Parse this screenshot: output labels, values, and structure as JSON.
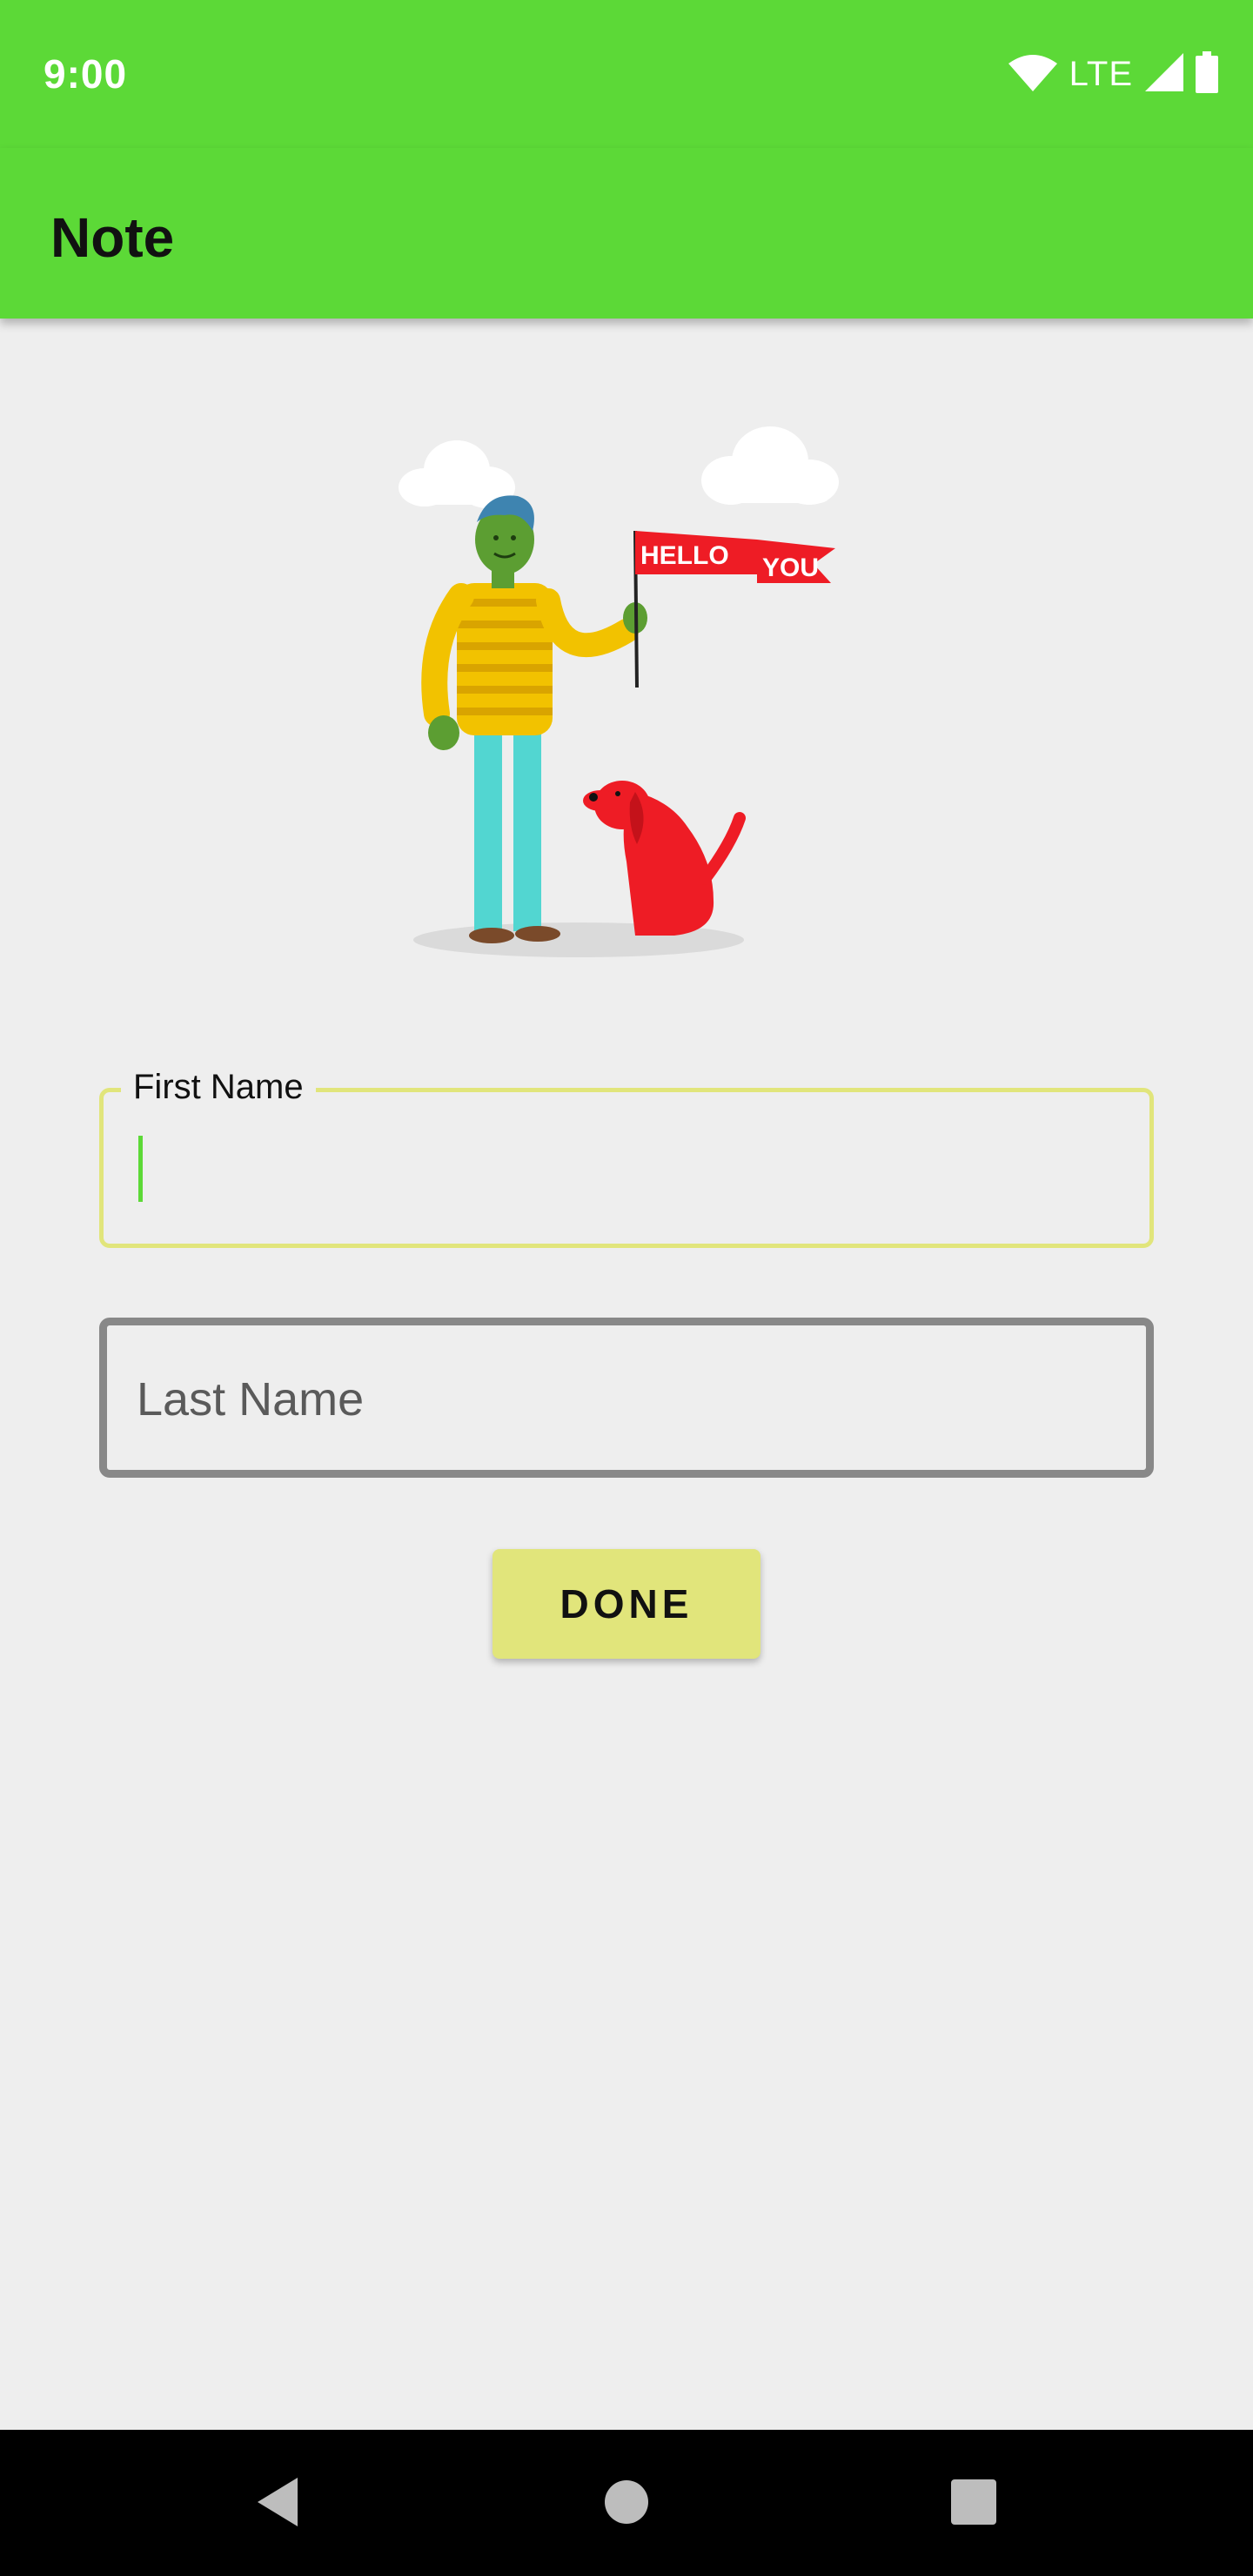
{
  "status_bar": {
    "time": "9:00",
    "network_label": "LTE",
    "icons": [
      "wifi-icon",
      "cell-signal-icon",
      "battery-icon"
    ]
  },
  "app_bar": {
    "title": "Note",
    "color": "#5cd937"
  },
  "illustration": {
    "flag_text_1": "HELLO",
    "flag_text_2": "YOU"
  },
  "form": {
    "first_name": {
      "label": "First Name",
      "value": "",
      "focused": true
    },
    "last_name": {
      "placeholder": "Last Name",
      "value": ""
    },
    "done_label": "DONE"
  },
  "nav_bar": {
    "buttons": [
      "back-icon",
      "home-icon",
      "recents-icon"
    ]
  },
  "colors": {
    "accent": "#5cd937",
    "field_focus_border": "#e1e57b",
    "button_bg": "#e1e57b",
    "background": "#eeeeee"
  }
}
